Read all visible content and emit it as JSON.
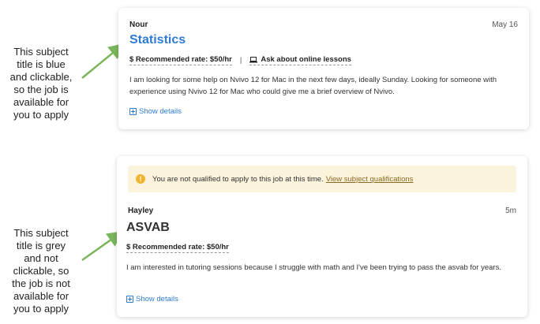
{
  "annotations": {
    "clickable_note": "This subject\ntitle is blue\nand clickable,\nso the job is\navailable for\nyou to apply",
    "not_clickable_note": "This subject\ntitle is grey\nand not\nclickable, so\nthe job is not\navailable for\nyou to apply"
  },
  "colors": {
    "title_blue": "#2f7bd2",
    "title_grey": "#333333",
    "arrow_green": "#7ab55c",
    "alert_bg": "#fbf3dc",
    "warning": "#f2b430"
  },
  "cards": [
    {
      "student": "Nour",
      "date": "May 16",
      "subject": "Statistics",
      "rate": "$ Recommended rate: $50/hr",
      "separator": "|",
      "ask_online": "Ask about online lessons",
      "description": "I am looking for some help on Nvivo 12 for Mac in the next few days, ideally Sunday. Looking for someone with experience using Nvivo 12 for Mac who could give me a brief overview of Nvivo.",
      "show_details": "Show details"
    },
    {
      "alert_text": "You are not qualified to apply to this job at this time.",
      "alert_link": "View subject qualifications",
      "student": "Hayley",
      "date": "5m",
      "subject": "ASVAB",
      "rate": "$ Recommended rate: $50/hr",
      "description": "I am interested in tutoring sessions because I struggle with math and I've been trying to pass the asvab for years.",
      "show_details": "Show details"
    }
  ]
}
